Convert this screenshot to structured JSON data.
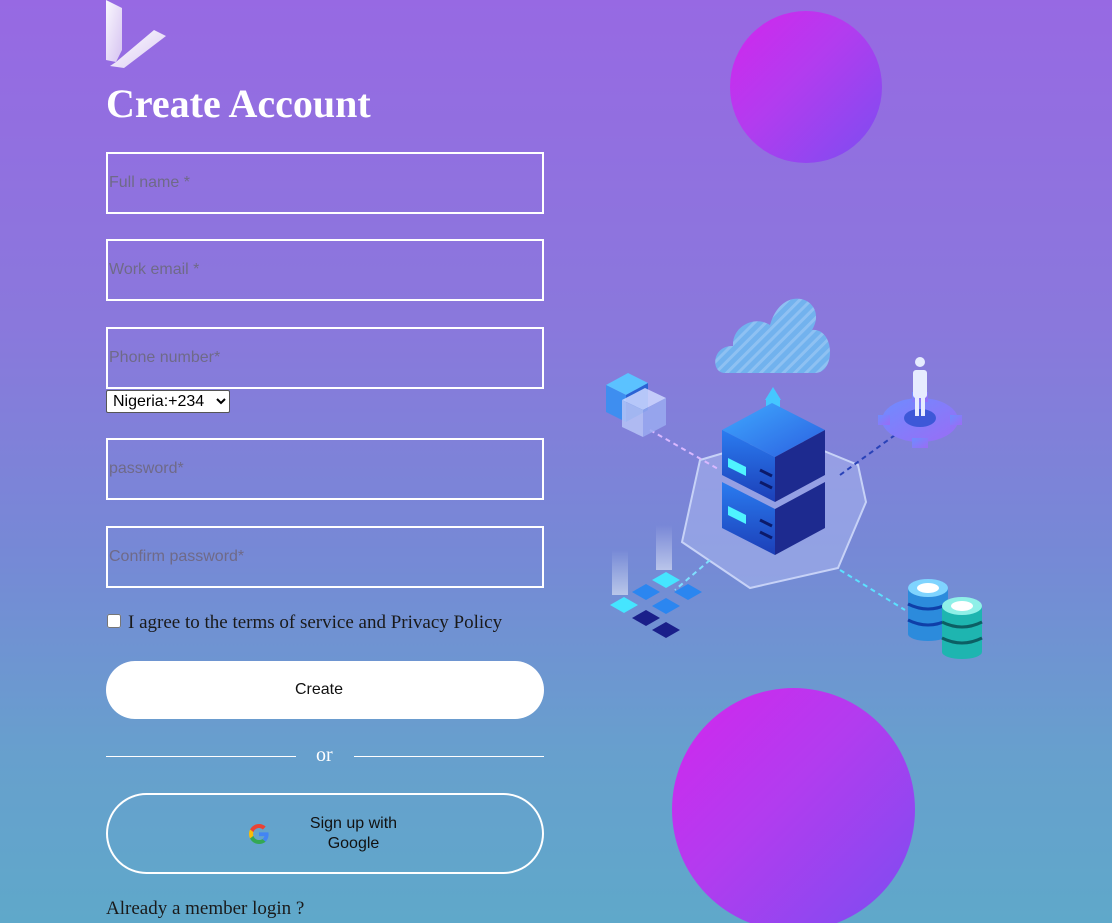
{
  "brand": {
    "logo_icon": "v-chevron-logo-icon"
  },
  "form": {
    "title": "Create Account",
    "full_name_placeholder": "Full name *",
    "email_placeholder": "Work email *",
    "phone_placeholder": "Phone number*",
    "country_code": "Nigeria:+234",
    "password_placeholder": "password*",
    "confirm_password_placeholder": "Confirm password*",
    "terms_label": "I agree to the terms of service and Privacy Policy",
    "terms_checked": false,
    "create_label": "Create",
    "divider_text": "or",
    "google_label": "Sign up with Google",
    "google_icon": "google-g-icon",
    "login_prompt": "Already a member login ?"
  },
  "illustration": {
    "icons": [
      "cloud-icon",
      "server-stack-icon",
      "folders-icon",
      "user-gear-icon",
      "chip-grid-icon",
      "database-icon"
    ]
  },
  "colors": {
    "background_top": "#9769e3",
    "background_bottom": "#5fa8ca",
    "circle_gradient_start": "#d326ee",
    "circle_gradient_end": "#7a4ef0",
    "text_white": "#ffffff"
  }
}
